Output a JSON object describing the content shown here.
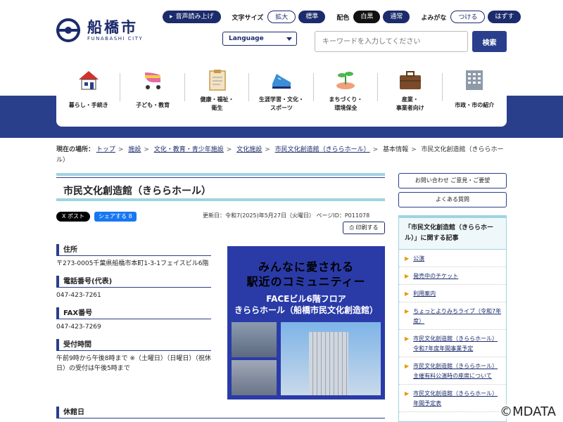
{
  "header": {
    "logo_jp": "船橋市",
    "logo_en": "FUNABASHI CITY",
    "read_aloud": "音声読み上げ",
    "text_size_label": "文字サイズ",
    "text_size_large": "拡大",
    "text_size_standard": "標準",
    "color_label": "配色",
    "color_white_black": "白黒",
    "color_normal": "通常",
    "furigana_label": "よみがな",
    "furigana_on": "つける",
    "furigana_off": "はずす",
    "language": "Language",
    "search_placeholder": "キーワードを入力してください",
    "search_button": "検索"
  },
  "nav": [
    {
      "label": "暮らし・手続き",
      "icon": "house-icon"
    },
    {
      "label": "子ども・教育",
      "icon": "stroller-icon"
    },
    {
      "label": "健康・福祉・\n衛生",
      "icon": "clipboard-icon"
    },
    {
      "label": "生涯学習・文化・\nスポーツ",
      "icon": "shoe-icon"
    },
    {
      "label": "まちづくり・\n環境保全",
      "icon": "sprout-icon"
    },
    {
      "label": "産業・\n事業者向け",
      "icon": "briefcase-icon"
    },
    {
      "label": "市政・市の紹介",
      "icon": "building-icon"
    }
  ],
  "breadcrumb": {
    "head": "現在の場所：",
    "links": [
      "トップ",
      "施設",
      "文化・教育・青少年施設",
      "文化施設",
      "市民文化創造館（きららホール）"
    ],
    "plain": [
      "基本情報",
      "市民文化創造館（きららホール）"
    ]
  },
  "page": {
    "title": "市民文化創造館（きららホール）",
    "x_post": "X ポスト",
    "fb_share": "シェアする 8",
    "meta": "更新日：令和7(2025)年5月27日（火曜日）  ページID：P011078",
    "print": "印刷する"
  },
  "info": [
    {
      "head": "住所",
      "body": "〒273-0005千葉県船橋市本町1-3-1フェイスビル6階"
    },
    {
      "head": "電話番号(代表)",
      "body": "047-423-7261"
    },
    {
      "head": "FAX番号",
      "body": "047-423-7269"
    },
    {
      "head": "受付時間",
      "body": "午前9時から午後8時まで ※（土曜日）（日曜日）（祝休日）の受付は午後5時まで"
    }
  ],
  "closed_head": "休館日",
  "banner": {
    "line1": "みんなに愛される",
    "line2": "駅近のコミュニティー",
    "line3": "FACEビル6階フロア",
    "line4": "きららホール（船橋市民文化創造館）"
  },
  "sidebar": {
    "inquiry": "お問い合わせ ご意見・ご要望",
    "faq": "よくある質問",
    "box_title": "「市民文化創造館（きららホール）」に関する記事",
    "items": [
      "公演",
      "発売中のチケット",
      "利用案内",
      "ちょっとよりみちライブ（令和7年度）",
      "市民文化創造館（きららホール）令和7年度年間事業予定",
      "市民文化創造館（きららホール）主催有料公演時の座席について",
      "市民文化創造館（きららホール）年間予定表"
    ]
  },
  "watermark": "©MDATA"
}
